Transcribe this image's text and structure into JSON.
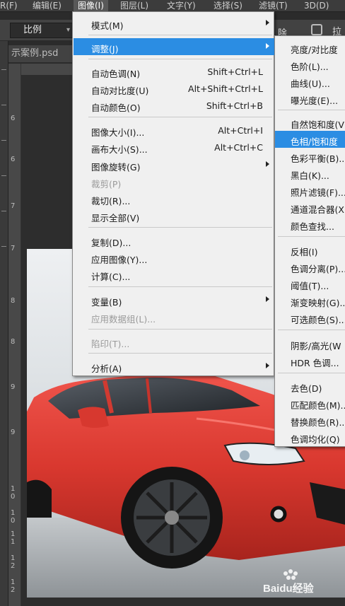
{
  "menubar": {
    "items": [
      "R(F)",
      "编辑(E)",
      "图像(I)",
      "图层(L)",
      "文字(Y)",
      "选择(S)",
      "滤镜(T)",
      "3D(D)"
    ]
  },
  "options": {
    "ratio_value": "比例",
    "btn_partial": "除",
    "txt_partial": "拉"
  },
  "document": {
    "tab_title": "示案例.psd"
  },
  "ruler": {
    "labels": [
      "6",
      "6",
      "7",
      "7",
      "8",
      "8",
      "9",
      "9",
      "1\n0",
      "1\n0",
      "1\n1",
      "1\n2",
      "1\n2"
    ]
  },
  "image_menu": {
    "items": [
      {
        "label": "模式(M)",
        "submenu": true
      },
      {
        "label": "调整(J)",
        "submenu": true,
        "highlighted": true
      },
      {
        "label": "自动色调(N)",
        "shortcut": "Shift+Ctrl+L"
      },
      {
        "label": "自动对比度(U)",
        "shortcut": "Alt+Shift+Ctrl+L"
      },
      {
        "label": "自动颜色(O)",
        "shortcut": "Shift+Ctrl+B"
      },
      {
        "label": "图像大小(I)...",
        "shortcut": "Alt+Ctrl+I"
      },
      {
        "label": "画布大小(S)...",
        "shortcut": "Alt+Ctrl+C"
      },
      {
        "label": "图像旋转(G)",
        "submenu": true
      },
      {
        "label": "裁剪(P)",
        "disabled": true
      },
      {
        "label": "裁切(R)..."
      },
      {
        "label": "显示全部(V)"
      },
      {
        "label": "复制(D)..."
      },
      {
        "label": "应用图像(Y)..."
      },
      {
        "label": "计算(C)..."
      },
      {
        "label": "变量(B)",
        "submenu": true
      },
      {
        "label": "应用数据组(L)...",
        "disabled": true
      },
      {
        "label": "陷印(T)...",
        "disabled": true
      },
      {
        "label": "分析(A)",
        "submenu": true
      }
    ]
  },
  "adjust_menu": {
    "items": [
      "亮度/对比度",
      "色阶(L)...",
      "曲线(U)...",
      "曝光度(E)...",
      "自然饱和度(V",
      "色相/饱和度",
      "色彩平衡(B)...",
      "黑白(K)...",
      "照片滤镜(F)...",
      "通道混合器(X",
      "颜色查找...",
      "反相(I)",
      "色调分离(P)...",
      "阈值(T)...",
      "渐变映射(G)...",
      "可选颜色(S)...",
      "阴影/高光(W",
      "HDR 色调...",
      "去色(D)",
      "匹配颜色(M)...",
      "替换颜色(R)...",
      "色调均化(Q)"
    ],
    "highlighted_index": 5
  },
  "watermark": {
    "text": "Baidu经验"
  },
  "colors": {
    "highlight": "#2b8de3",
    "car": "#e2413b",
    "menu_bg": "#f0f0f0"
  }
}
